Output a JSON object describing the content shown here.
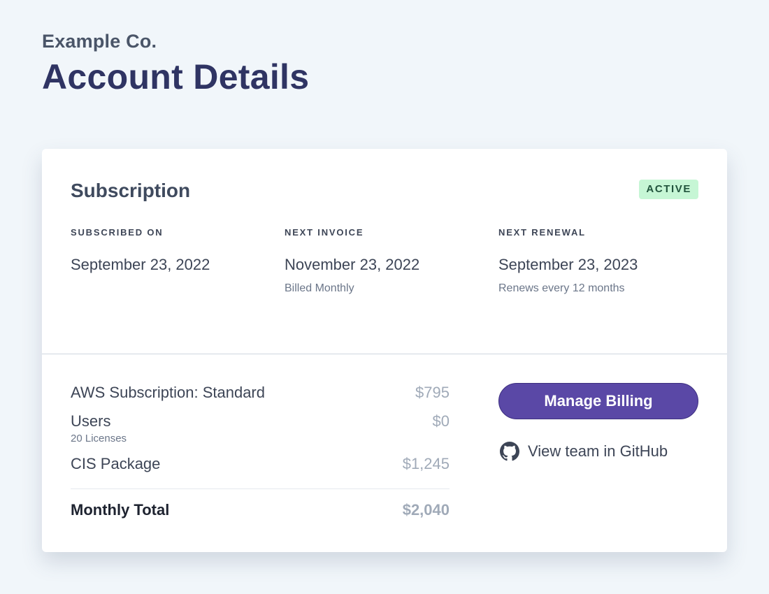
{
  "header": {
    "company": "Example Co.",
    "title": "Account Details"
  },
  "subscription": {
    "title": "Subscription",
    "status": "ACTIVE",
    "status_color": "#c6f6d5",
    "columns": [
      {
        "label": "SUBSCRIBED ON",
        "value": "September 23, 2022",
        "sub": ""
      },
      {
        "label": "NEXT INVOICE",
        "value": "November 23, 2022",
        "sub": "Billed Monthly"
      },
      {
        "label": "NEXT RENEWAL",
        "value": "September 23, 2023",
        "sub": "Renews every 12 months"
      }
    ]
  },
  "line_items": [
    {
      "label": "AWS Subscription: Standard",
      "value": "$795"
    },
    {
      "label": "Users",
      "sub": "20 Licenses",
      "value": "$0"
    },
    {
      "label": "CIS Package",
      "value": "$1,245"
    }
  ],
  "total": {
    "label": "Monthly Total",
    "value": "$2,040"
  },
  "actions": {
    "manage_billing": "Manage Billing",
    "github_link": "View team in GitHub",
    "github_icon": "github-icon",
    "accent_color": "#5a48a6"
  }
}
